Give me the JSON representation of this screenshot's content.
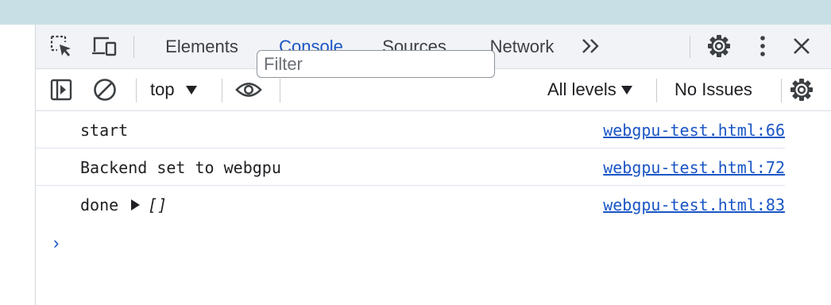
{
  "colors": {
    "accent": "#1a56c5",
    "toolbar_bg": "#f1f3f6",
    "top_strip": "#c8e0e5",
    "text": "#202124"
  },
  "toolbar": {
    "icons": {
      "inspect": "inspect-element-icon",
      "device": "device-toolbar-icon",
      "more_tabs": "chevron-double-right-icon",
      "settings": "gear-icon",
      "menu": "kebab-menu-icon",
      "close": "close-icon"
    },
    "tabs": [
      {
        "label": "Elements",
        "active": false
      },
      {
        "label": "Console",
        "active": true
      },
      {
        "label": "Sources",
        "active": false
      },
      {
        "label": "Network",
        "active": false
      }
    ]
  },
  "console_toolbar": {
    "context": "top",
    "filter_placeholder": "Filter",
    "filter_value": "",
    "levels": "All levels",
    "issues": "No Issues",
    "icons": {
      "sidebar": "sidebar-toggle-icon",
      "clear": "clear-console-icon",
      "live_expression": "eye-icon",
      "settings": "gear-icon"
    }
  },
  "messages": [
    {
      "text": "start",
      "source": "webgpu-test.html:66"
    },
    {
      "text": "Backend set to webgpu",
      "source": "webgpu-test.html:72"
    },
    {
      "text": "done",
      "object": "[]",
      "source": "webgpu-test.html:83"
    }
  ],
  "prompt_symbol": "›"
}
